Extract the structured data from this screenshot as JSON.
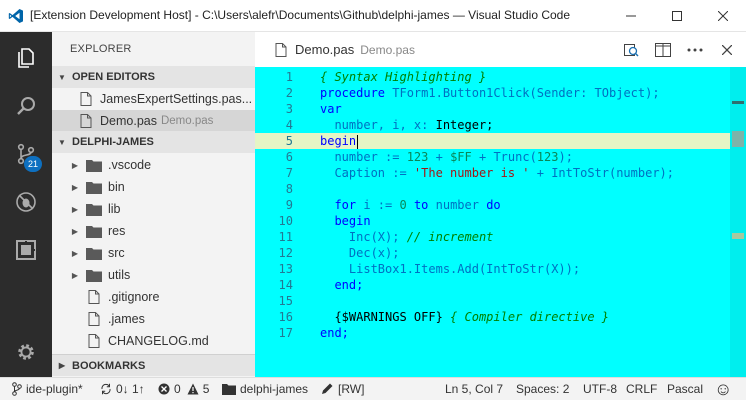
{
  "window": {
    "title": "[Extension Development Host] - C:\\Users\\alefr\\Documents\\Github\\delphi-james — Visual Studio Code",
    "min_glyph": "—",
    "max_glyph": "☐",
    "close_glyph": "✕"
  },
  "activity_bar": {
    "items": [
      "files-icon",
      "search-icon",
      "source-control-icon",
      "debug-icon",
      "extensions-icon",
      "settings-gear-icon"
    ],
    "scm_badge": "21"
  },
  "sidebar": {
    "title": "EXPLORER",
    "open_editors": {
      "label": "OPEN EDITORS",
      "items": [
        {
          "name": "JamesExpertSettings.pas...",
          "desc": ""
        },
        {
          "name": "Demo.pas",
          "desc": "Demo.pas"
        }
      ]
    },
    "project": {
      "label": "DELPHI-JAMES",
      "folders": [
        ".vscode",
        "bin",
        "lib",
        "res",
        "src",
        "utils"
      ],
      "files": [
        ".gitignore",
        ".james",
        "CHANGELOG.md"
      ]
    },
    "bookmarks": {
      "label": "BOOKMARKS"
    }
  },
  "editor": {
    "tab": {
      "label": "Demo.pas",
      "desc": "Demo.pas"
    },
    "line_numbers": [
      "1",
      "2",
      "3",
      "4",
      "5",
      "6",
      "7",
      "8",
      "9",
      "10",
      "11",
      "12",
      "13",
      "14",
      "15",
      "16",
      "17"
    ],
    "current_line": 5,
    "lines": [
      [
        {
          "t": "{ Syntax Highlighting }",
          "c": "c"
        }
      ],
      [
        {
          "t": "procedure ",
          "c": "k"
        },
        {
          "t": "TForm1.Button1Click(Sender: TObject);",
          "c": "i"
        }
      ],
      [
        {
          "t": "var",
          "c": "k"
        }
      ],
      [
        {
          "t": "  number, i, x: ",
          "c": "i"
        },
        {
          "t": "Integer;",
          "c": "p"
        }
      ],
      [
        {
          "t": "begin",
          "c": "k"
        }
      ],
      [
        {
          "t": "  number := ",
          "c": "i"
        },
        {
          "t": "123",
          "c": "n"
        },
        {
          "t": " + ",
          "c": "i"
        },
        {
          "t": "$FF",
          "c": "n"
        },
        {
          "t": " + Trunc(",
          "c": "i"
        },
        {
          "t": "123",
          "c": "n"
        },
        {
          "t": ");",
          "c": "i"
        }
      ],
      [
        {
          "t": "  Caption := ",
          "c": "i"
        },
        {
          "t": "'The number is '",
          "c": "s"
        },
        {
          "t": " + IntToStr(number);",
          "c": "i"
        }
      ],
      [
        {
          "t": "",
          "c": "p"
        }
      ],
      [
        {
          "t": "  for ",
          "c": "k"
        },
        {
          "t": "i := ",
          "c": "i"
        },
        {
          "t": "0",
          "c": "n"
        },
        {
          "t": " to ",
          "c": "k"
        },
        {
          "t": "number ",
          "c": "i"
        },
        {
          "t": "do",
          "c": "k"
        }
      ],
      [
        {
          "t": "  begin",
          "c": "k"
        }
      ],
      [
        {
          "t": "    Inc(X); ",
          "c": "i"
        },
        {
          "t": "// increment",
          "c": "c"
        }
      ],
      [
        {
          "t": "    Dec(x);",
          "c": "i"
        }
      ],
      [
        {
          "t": "    ListBox1.Items.Add(IntToStr(X));",
          "c": "i"
        }
      ],
      [
        {
          "t": "  end;",
          "c": "k"
        }
      ],
      [
        {
          "t": "",
          "c": "p"
        }
      ],
      [
        {
          "t": "  {$WARNINGS OFF}",
          "c": "p"
        },
        {
          "t": " { Compiler directive }",
          "c": "c"
        }
      ],
      [
        {
          "t": "end;",
          "c": "k"
        }
      ]
    ],
    "tab_actions": [
      "open-changes-icon",
      "split-editor-icon",
      "more-icon",
      "close-group-icon"
    ]
  },
  "status_bar": {
    "branch": "ide-plugin*",
    "sync": "0↓ 1↑",
    "errors": "0",
    "warnings": "5",
    "project": "delphi-james",
    "readwrite": "[RW]",
    "position": "Ln 5, Col 7",
    "spaces": "Spaces: 2",
    "encoding": "UTF-8",
    "eol": "CRLF",
    "language": "Pascal",
    "feedback_glyph": "☺"
  }
}
